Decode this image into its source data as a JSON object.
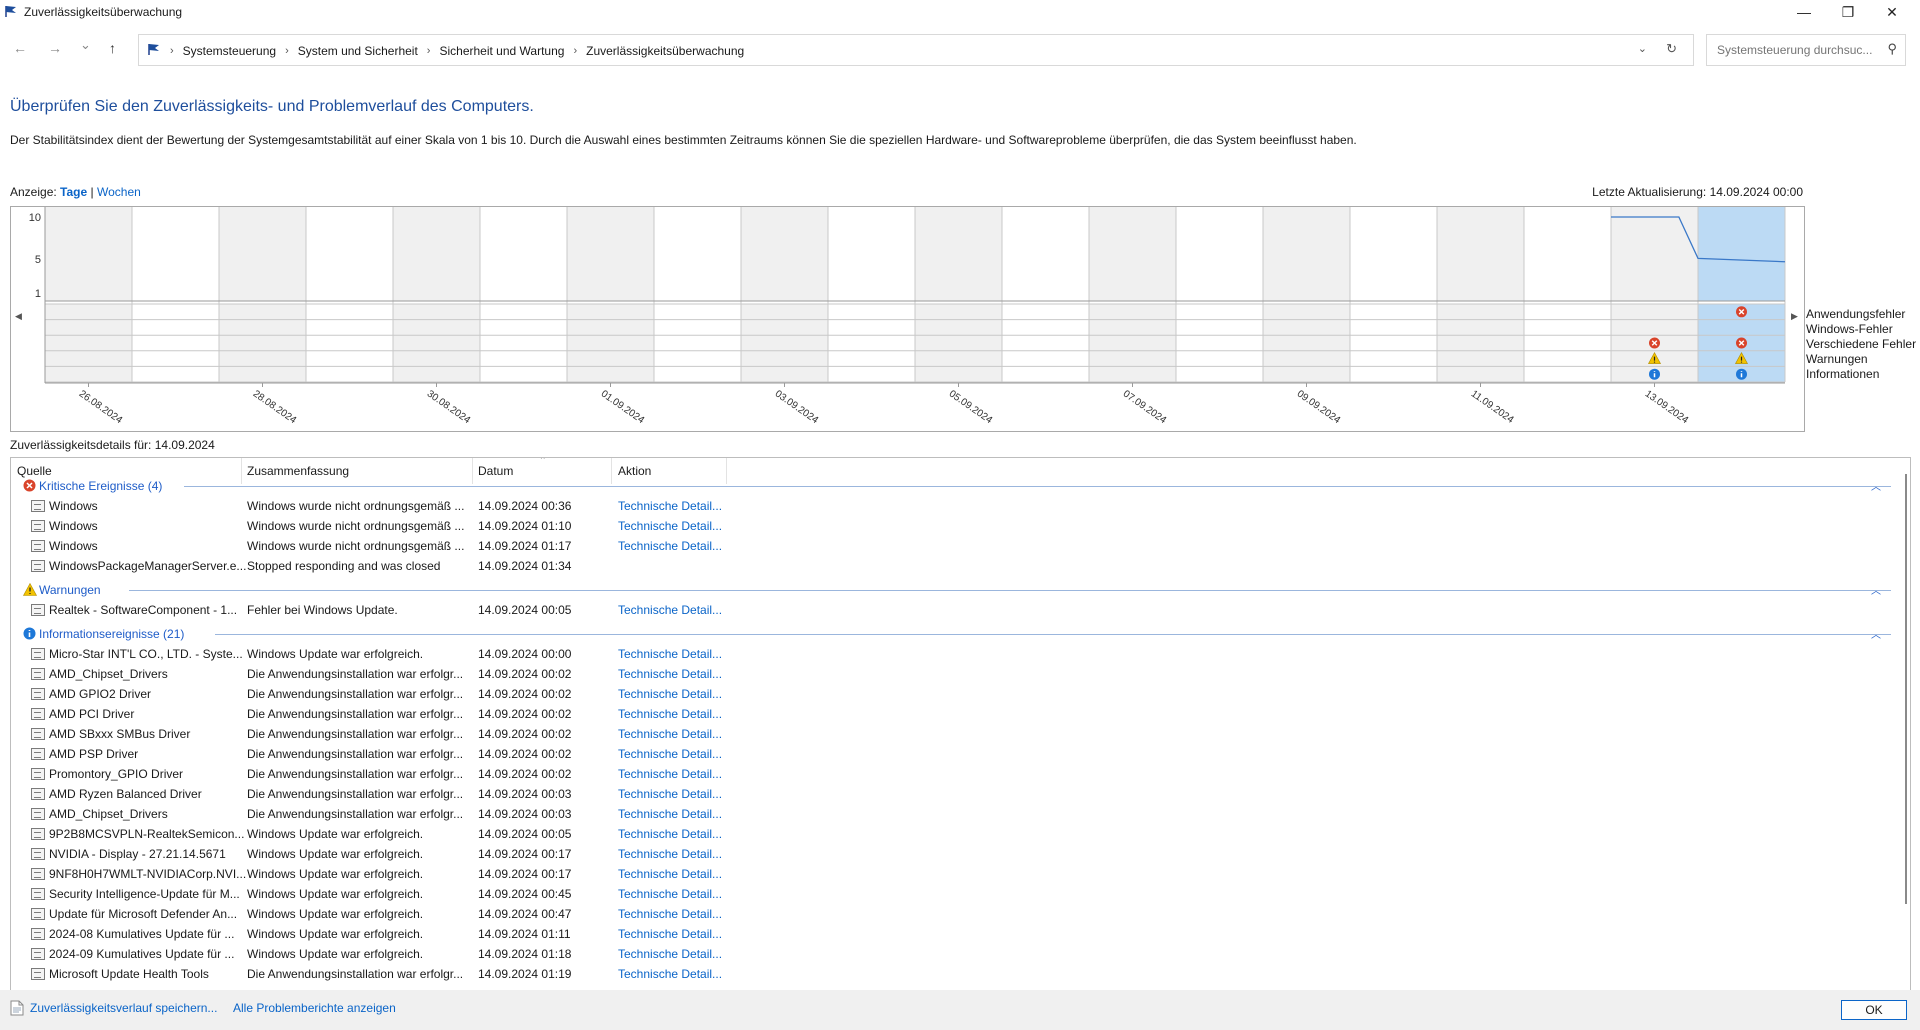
{
  "window": {
    "title": "Zuverlässigkeitsüberwachung",
    "minimize": "—",
    "maximize": "❐",
    "close": "✕"
  },
  "nav": {
    "back": "←",
    "forward": "→",
    "recent": "⌄",
    "up": "↑",
    "breadcrumbs": [
      "Systemsteuerung",
      "System und Sicherheit",
      "Sicherheit und Wartung",
      "Zuverlässigkeitsüberwachung"
    ],
    "search_placeholder": "Systemsteuerung durchsuc..."
  },
  "heading": "Überprüfen Sie den Zuverlässigkeits- und Problemverlauf des Computers.",
  "description": "Der Stabilitätsindex dient der Bewertung der Systemgesamtstabilität auf einer Skala von 1 bis 10. Durch die Auswahl eines bestimmten Zeitraums können Sie die speziellen Hardware- und Softwareprobleme überprüfen, die das System beeinflusst haben.",
  "view": {
    "label": "Anzeige:",
    "days": "Tage",
    "sep": "|",
    "weeks": "Wochen"
  },
  "last_update": "Letzte Aktualisierung: 14.09.2024 00:00",
  "chart_data": {
    "type": "line",
    "y_ticks": [
      "10",
      "5",
      "1"
    ],
    "ylim": [
      1,
      10
    ],
    "x_labels": [
      "26.08.2024",
      "28.08.2024",
      "30.08.2024",
      "01.09.2024",
      "03.09.2024",
      "05.09.2024",
      "07.09.2024",
      "09.09.2024",
      "11.09.2024",
      "13.09.2024"
    ],
    "days_shown": 20,
    "selected_day": "14.09.2024",
    "stability_index": [
      {
        "day": "13.09.2024",
        "value": 10
      },
      {
        "day": "13.09.2024 (evening)",
        "value": 10
      },
      {
        "day": "14.09.2024",
        "value": 5.1
      },
      {
        "day": "14.09.2024 (end)",
        "value": 4.7
      }
    ],
    "legend": [
      "Anwendungsfehler",
      "Windows-Fehler",
      "Verschiedene Fehler",
      "Warnungen",
      "Informationen"
    ],
    "events": [
      {
        "day": "13.09.2024",
        "rows": [
          "Verschiedene Fehler",
          "Warnungen",
          "Informationen"
        ]
      },
      {
        "day": "14.09.2024",
        "rows": [
          "Anwendungsfehler",
          "Verschiedene Fehler",
          "Warnungen",
          "Informationen"
        ]
      }
    ],
    "colors": {
      "line": "#3a78c8",
      "selected": "#bcdaf4",
      "shaded": "#f0f0f0",
      "error": "#d9442b",
      "warning": "#f2c200",
      "info": "#1e78d8"
    }
  },
  "details": {
    "label": "Zuverlässigkeitsdetails für: 14.09.2024",
    "columns": [
      "Quelle",
      "Zusammenfassung",
      "Datum",
      "Aktion"
    ],
    "groups": [
      {
        "title": "Kritische Ereignisse (4)",
        "icon": "error-icon",
        "rows": [
          {
            "source": "Windows",
            "summary": "Windows wurde nicht ordnungsgemäß ...",
            "date": "14.09.2024 00:36",
            "action": "Technische Detail..."
          },
          {
            "source": "Windows",
            "summary": "Windows wurde nicht ordnungsgemäß ...",
            "date": "14.09.2024 01:10",
            "action": "Technische Detail..."
          },
          {
            "source": "Windows",
            "summary": "Windows wurde nicht ordnungsgemäß ...",
            "date": "14.09.2024 01:17",
            "action": "Technische Detail..."
          },
          {
            "source": "WindowsPackageManagerServer.e...",
            "summary": "Stopped responding and was closed",
            "date": "14.09.2024 01:34",
            "action": ""
          }
        ]
      },
      {
        "title": "Warnungen",
        "icon": "warning-icon",
        "rows": [
          {
            "source": "Realtek - SoftwareComponent - 1...",
            "summary": "Fehler bei Windows Update.",
            "date": "14.09.2024 00:05",
            "action": "Technische Detail..."
          }
        ]
      },
      {
        "title": "Informationsereignisse (21)",
        "icon": "info-icon",
        "rows": [
          {
            "source": "Micro-Star INT'L CO., LTD. - Syste...",
            "summary": "Windows Update war erfolgreich.",
            "date": "14.09.2024 00:00",
            "action": "Technische Detail..."
          },
          {
            "source": "AMD_Chipset_Drivers",
            "summary": "Die Anwendungsinstallation war erfolgr...",
            "date": "14.09.2024 00:02",
            "action": "Technische Detail..."
          },
          {
            "source": "AMD GPIO2 Driver",
            "summary": "Die Anwendungsinstallation war erfolgr...",
            "date": "14.09.2024 00:02",
            "action": "Technische Detail..."
          },
          {
            "source": "AMD PCI Driver",
            "summary": "Die Anwendungsinstallation war erfolgr...",
            "date": "14.09.2024 00:02",
            "action": "Technische Detail..."
          },
          {
            "source": "AMD SBxxx SMBus Driver",
            "summary": "Die Anwendungsinstallation war erfolgr...",
            "date": "14.09.2024 00:02",
            "action": "Technische Detail..."
          },
          {
            "source": "AMD PSP Driver",
            "summary": "Die Anwendungsinstallation war erfolgr...",
            "date": "14.09.2024 00:02",
            "action": "Technische Detail..."
          },
          {
            "source": "Promontory_GPIO Driver",
            "summary": "Die Anwendungsinstallation war erfolgr...",
            "date": "14.09.2024 00:02",
            "action": "Technische Detail..."
          },
          {
            "source": "AMD Ryzen Balanced Driver",
            "summary": "Die Anwendungsinstallation war erfolgr...",
            "date": "14.09.2024 00:03",
            "action": "Technische Detail..."
          },
          {
            "source": "AMD_Chipset_Drivers",
            "summary": "Die Anwendungsinstallation war erfolgr...",
            "date": "14.09.2024 00:03",
            "action": "Technische Detail..."
          },
          {
            "source": "9P2B8MCSVPLN-RealtekSemicon...",
            "summary": "Windows Update war erfolgreich.",
            "date": "14.09.2024 00:05",
            "action": "Technische Detail..."
          },
          {
            "source": "NVIDIA - Display - 27.21.14.5671",
            "summary": "Windows Update war erfolgreich.",
            "date": "14.09.2024 00:17",
            "action": "Technische Detail..."
          },
          {
            "source": "9NF8H0H7WMLT-NVIDIACorp.NVI...",
            "summary": "Windows Update war erfolgreich.",
            "date": "14.09.2024 00:17",
            "action": "Technische Detail..."
          },
          {
            "source": "Security Intelligence-Update für M...",
            "summary": "Windows Update war erfolgreich.",
            "date": "14.09.2024 00:45",
            "action": "Technische Detail..."
          },
          {
            "source": "Update für Microsoft Defender An...",
            "summary": "Windows Update war erfolgreich.",
            "date": "14.09.2024 00:47",
            "action": "Technische Detail..."
          },
          {
            "source": "2024-08 Kumulatives Update für ...",
            "summary": "Windows Update war erfolgreich.",
            "date": "14.09.2024 01:11",
            "action": "Technische Detail..."
          },
          {
            "source": "2024-09 Kumulatives Update für ...",
            "summary": "Windows Update war erfolgreich.",
            "date": "14.09.2024 01:18",
            "action": "Technische Detail..."
          },
          {
            "source": "Microsoft Update Health Tools",
            "summary": "Die Anwendungsinstallation war erfolgr...",
            "date": "14.09.2024 01:19",
            "action": "Technische Detail..."
          }
        ]
      }
    ]
  },
  "footer": {
    "save_link": "Zuverlässigkeitsverlauf speichern...",
    "reports_link": "Alle Problemberichte anzeigen",
    "ok": "OK"
  }
}
